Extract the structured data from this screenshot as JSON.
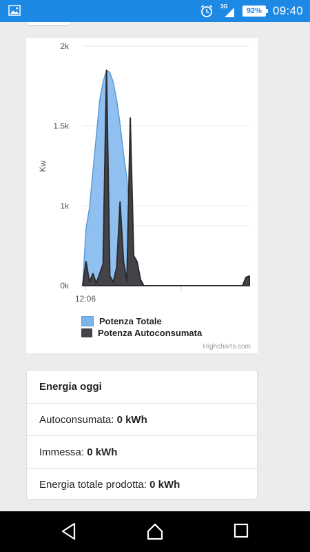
{
  "status_bar": {
    "network": "3G",
    "battery": "92%",
    "time": "09:40",
    "icons": [
      "image-icon",
      "alarm-icon",
      "signal-icon",
      "battery-icon"
    ]
  },
  "chart": {
    "chart_data": {
      "type": "area",
      "ylabel": "Kw",
      "y_ticks": [
        "2k",
        "1.5k",
        "1k",
        "0k"
      ],
      "x_ticks": [
        "12:06"
      ],
      "ylim": [
        0,
        2000
      ],
      "grid": true,
      "legend_placement": "bottom-left",
      "series": [
        {
          "name": "Potenza Totale",
          "color": "#7cb5ec",
          "values": [
            0,
            480,
            650,
            950,
            1250,
            1550,
            1700,
            1800,
            1780,
            1700,
            1550,
            1350,
            1100,
            900,
            500,
            150,
            50,
            20,
            0,
            0,
            0,
            0,
            0,
            0,
            0,
            0,
            0,
            0,
            0,
            0,
            0,
            0,
            0,
            0,
            0,
            0,
            0,
            0,
            0,
            0,
            0,
            0,
            0,
            0,
            0,
            0,
            0,
            0,
            0,
            0
          ]
        },
        {
          "name": "Potenza Autoconsumata",
          "color": "#434348",
          "values": [
            0,
            200,
            30,
            100,
            20,
            100,
            180,
            1800,
            80,
            30,
            150,
            700,
            200,
            40,
            1400,
            250,
            200,
            50,
            0,
            0,
            0,
            0,
            0,
            0,
            0,
            0,
            0,
            0,
            0,
            0,
            0,
            0,
            0,
            0,
            0,
            0,
            0,
            0,
            0,
            0,
            0,
            0,
            0,
            0,
            0,
            0,
            0,
            0,
            70,
            80
          ]
        }
      ]
    },
    "credits": "Highcharts.com"
  },
  "energy": {
    "header": "Energia oggi",
    "rows": [
      {
        "label": "Autoconsumata: ",
        "value": "0 kWh"
      },
      {
        "label": "Immessa: ",
        "value": "0 kWh"
      },
      {
        "label": "Energia totale prodotta: ",
        "value": "0 kWh"
      }
    ]
  },
  "nav_bar": {
    "icons": [
      "back-icon",
      "home-icon",
      "recents-icon"
    ]
  }
}
